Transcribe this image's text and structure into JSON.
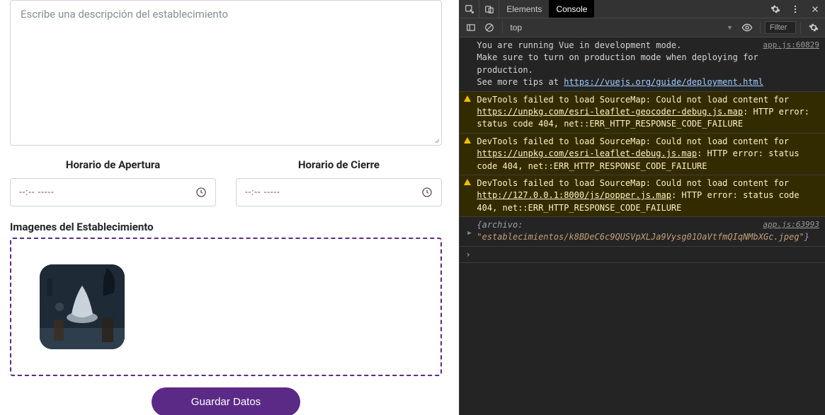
{
  "form": {
    "description_placeholder": "Escribe una descripción del establecimiento",
    "open_label": "Horario de Apertura",
    "close_label": "Horario de Cierre",
    "time_placeholder": "--:-- -----",
    "images_label": "Imagenes del Establecimiento",
    "submit_label": "Guardar Datos"
  },
  "devtools": {
    "tabs": {
      "elements": "Elements",
      "console": "Console"
    },
    "context": "top",
    "filter_placeholder": "Filter",
    "messages": {
      "vue_l1": "You are running Vue in development mode.",
      "vue_l2": "Make sure to turn on production mode when deploying for production.",
      "vue_l3": "See more tips at ",
      "vue_link": "https://vuejs.org/guide/deployment.html",
      "vue_src": "app.js:60829",
      "w1_a": "DevTools failed to load SourceMap: Could not load content for ",
      "w1_link": "https://unpkg.com/esri-leaflet-geocoder-debug.js.map",
      "w1_b": ": HTTP error: status code 404, net::ERR_HTTP_RESPONSE_CODE_FAILURE",
      "w2_a": "DevTools failed to load SourceMap: Could not load content for ",
      "w2_link": "https://unpkg.com/esri-leaflet-debug.js.map",
      "w2_b": ": HTTP error: status code 404, net::ERR_HTTP_RESPONSE_CODE_FAILURE",
      "w3_a": "DevTools failed to load SourceMap: Could not load content for ",
      "w3_link": "http://127.0.0.1:8000/js/popper.js.map",
      "w3_b": ": HTTP error: status code 404, net::ERR_HTTP_RESPONSE_CODE_FAILURE",
      "obj_src": "app.js:63993",
      "obj_open": "{",
      "obj_key": "archivo:",
      "obj_val": "\"establecimientos/k8BDeC6c9QUSVpXLJa9Vysg01OaVtfmQIqNMbXGc.jpeg\"",
      "obj_close": "}"
    }
  }
}
